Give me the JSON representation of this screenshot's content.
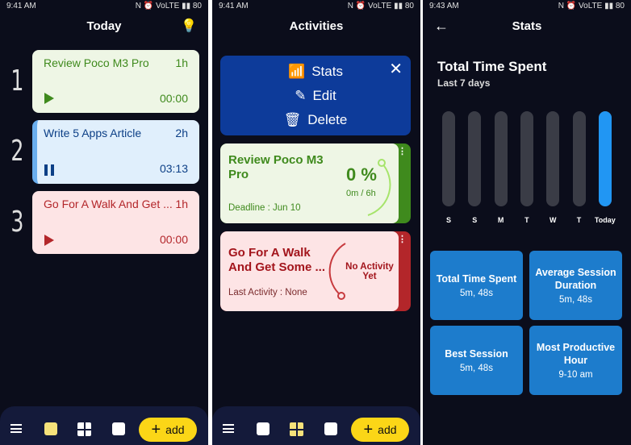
{
  "today": {
    "status_time": "9:41 AM",
    "status_right": "N ⏰ VoLTE ▮▮ 80",
    "title": "Today",
    "tasks": [
      {
        "index": "1",
        "name": "Review Poco M3 Pro",
        "duration": "1h",
        "timer": "00:00",
        "state": "play",
        "color": "#3f8a1d",
        "bg": "#eef6e5"
      },
      {
        "index": "2",
        "name": "Write 5 Apps Article",
        "duration": "2h",
        "timer": "03:13",
        "state": "pause",
        "color": "#0c3f86",
        "bg": "#e0effc"
      },
      {
        "index": "3",
        "name": "Go For A Walk And Get ...",
        "duration": "1h",
        "timer": "00:00",
        "state": "play",
        "color": "#b3262a",
        "bg": "#fde4e5"
      }
    ]
  },
  "activities": {
    "status_time": "9:41 AM",
    "status_right": "N ⏰ VoLTE ▮▮ 80",
    "title": "Activities",
    "menu": {
      "stats": "Stats",
      "edit": "Edit",
      "delete": "Delete"
    },
    "cards": [
      {
        "name": "Review Poco M3 Pro",
        "meta": "Deadline : Jun 10",
        "percent": "0 %",
        "progress": "0m / 6h"
      },
      {
        "name": "Go For A Walk And Get Some ...",
        "meta": "Last Activity : None",
        "status": "No Activity Yet"
      }
    ]
  },
  "stats": {
    "status_time": "9:43 AM",
    "status_right": "N ⏰ VoLTE ▮▮ 80",
    "title": "Stats",
    "heading": "Total Time Spent",
    "period": "Last 7 days",
    "days": [
      "S",
      "S",
      "M",
      "T",
      "W",
      "T",
      "Today"
    ],
    "day_fill": [
      0,
      0,
      0,
      0,
      0,
      0,
      1
    ],
    "tiles": [
      {
        "label": "Total Time Spent",
        "value": "5m, 48s"
      },
      {
        "label": "Average Session Duration",
        "value": "5m, 48s"
      },
      {
        "label": "Best Session",
        "value": "5m, 48s"
      },
      {
        "label": "Most Productive Hour",
        "value": "9-10 am"
      }
    ]
  },
  "nav": {
    "add_label": "add"
  }
}
